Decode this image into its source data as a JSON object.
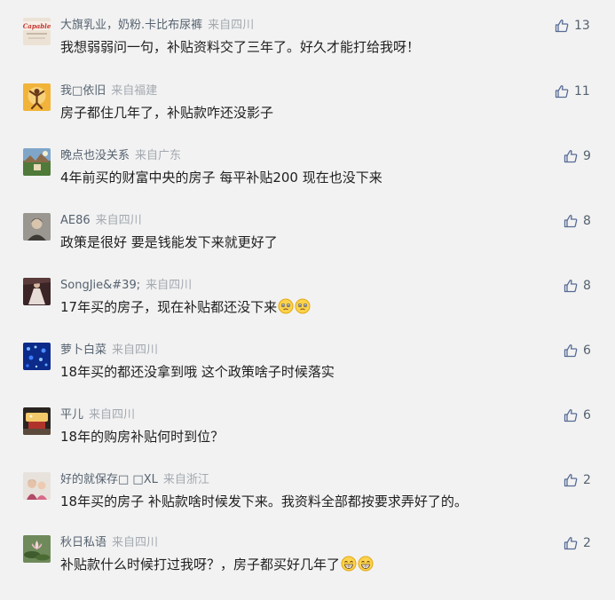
{
  "comments": [
    {
      "username": "大旗乳业，奶粉.卡比布尿裤",
      "location": "来自四川",
      "text": "我想弱弱问一句，补贴资料交了三年了。好久才能打给我呀！",
      "likes": "13",
      "avatar_icon": "capable-logo-avatar",
      "emojis": []
    },
    {
      "username": "我□依旧",
      "location": "来自福建",
      "text": "房子都住几年了，补贴款咋还没影子",
      "likes": "11",
      "avatar_icon": "yoga-silhouette-avatar",
      "emojis": []
    },
    {
      "username": "晚点也没关系",
      "location": "来自广东",
      "text": "4年前买的财富中央的房子 每平补贴200 现在也没下来",
      "likes": "9",
      "avatar_icon": "landscape-avatar",
      "emojis": []
    },
    {
      "username": "AE86",
      "location": "来自四川",
      "text": "政策是很好 要是钱能发下来就更好了",
      "likes": "8",
      "avatar_icon": "portrait-avatar",
      "emojis": []
    },
    {
      "username": "SongJie&#39;",
      "location": "来自四川",
      "text": "17年买的房子，现在补贴都还没下来",
      "likes": "8",
      "avatar_icon": "gown-avatar",
      "emojis": [
        "worried-emoji",
        "worried-emoji"
      ]
    },
    {
      "username": "萝卜白菜",
      "location": "来自四川",
      "text": "18年买的都还没拿到哦 这个政策啥子时候落实",
      "likes": "6",
      "avatar_icon": "blue-lights-avatar",
      "emojis": []
    },
    {
      "username": "平儿",
      "location": "来自四川",
      "text": "18年的购房补贴何时到位？",
      "likes": "6",
      "avatar_icon": "cake-avatar",
      "emojis": []
    },
    {
      "username": "好的就保存□ □XL",
      "location": "来自浙江",
      "text": "18年买的房子 补贴款啥时候发下来。我资料全部都按要求弄好了的。",
      "likes": "2",
      "avatar_icon": "two-people-avatar",
      "emojis": []
    },
    {
      "username": "秋日私语",
      "location": "来自四川",
      "text": "补贴款什么时候打过我呀？，房子都买好几年了",
      "likes": "2",
      "avatar_icon": "lotus-avatar",
      "emojis": [
        "grin-emoji",
        "grin-emoji"
      ]
    }
  ],
  "colors": {
    "background": "#f2f2f2",
    "username": "#55626f",
    "location": "#a3a9b0",
    "text": "#1e1e1e",
    "like_icon": "#576b95"
  },
  "icons": {
    "like": "thumbs-up-icon"
  }
}
